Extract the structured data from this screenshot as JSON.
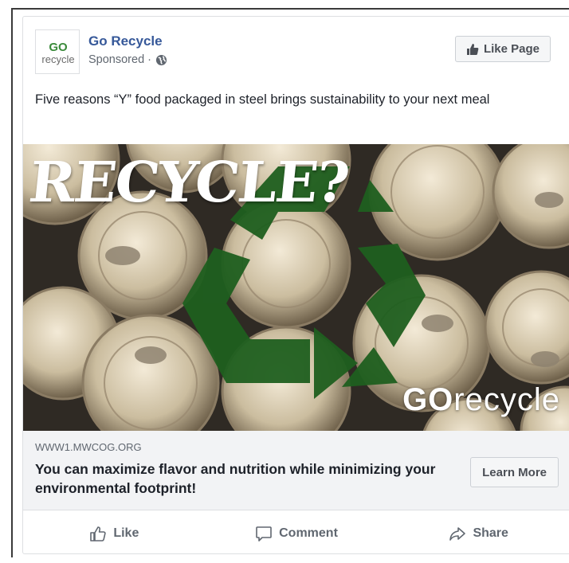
{
  "post": {
    "page_name": "Go Recycle",
    "sponsored_label": "Sponsored ·",
    "like_page_label": "Like Page",
    "text": "Five reasons “Y” food packaged in steel brings sustainability to your next meal",
    "logo": {
      "top": "GO",
      "bottom": "recycle",
      "accent": "#3a8a3a"
    }
  },
  "ad_image": {
    "headline": "RECYCLE?",
    "brand_bold": "GO",
    "brand_rest": "recycle",
    "symbol_color": "#1f5f1f",
    "description_icon": "recycle-symbol"
  },
  "link": {
    "domain": "WWW1.MWCOG.ORG",
    "title": "You can maximize flavor and nutrition while minimizing your environmental footprint!",
    "cta_label": "Learn More"
  },
  "actions": [
    {
      "label": "Like",
      "icon": "thumbs-up-icon"
    },
    {
      "label": "Comment",
      "icon": "comment-icon"
    },
    {
      "label": "Share",
      "icon": "share-icon"
    }
  ],
  "colors": {
    "link_blue": "#365899",
    "secondary_text": "#606770",
    "link_bg": "#f2f3f5"
  }
}
